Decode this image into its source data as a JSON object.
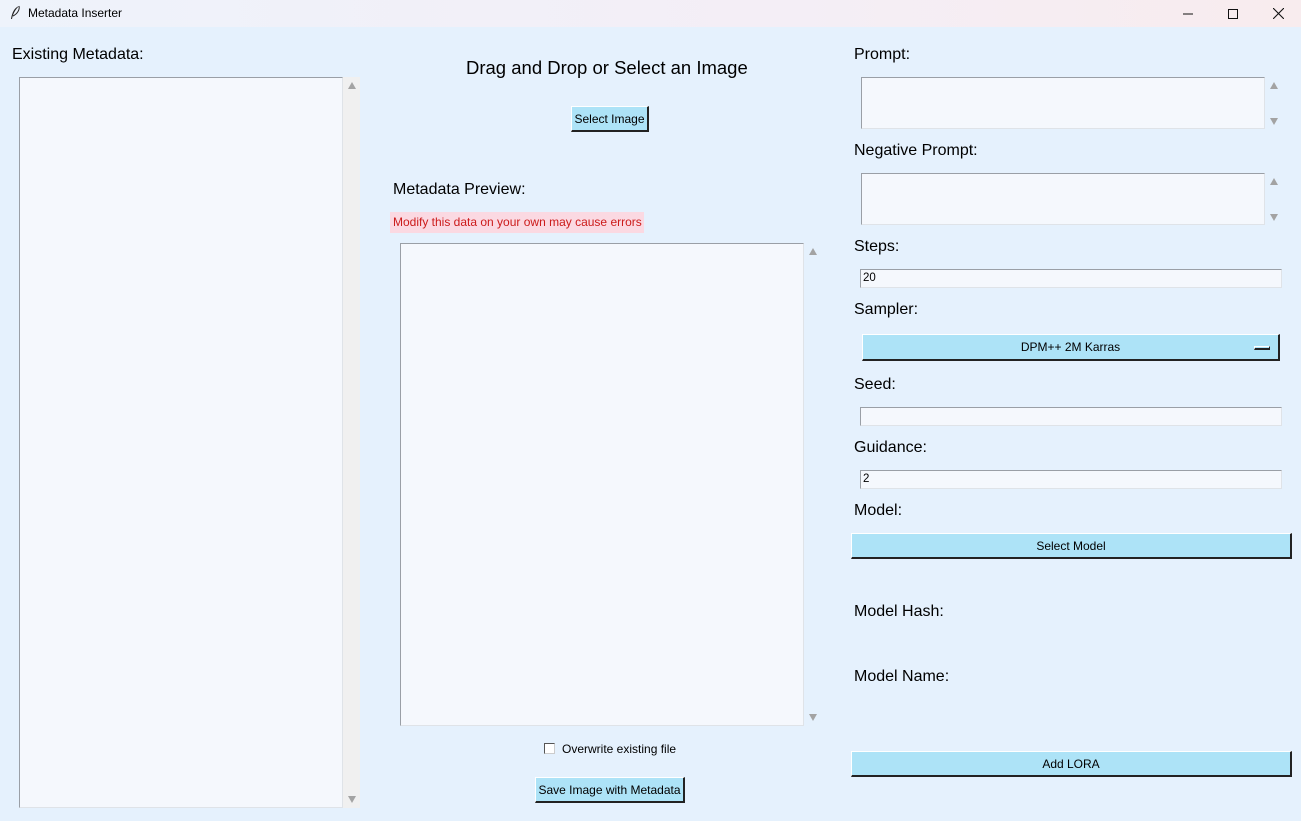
{
  "window": {
    "title": "Metadata Inserter",
    "minimize_icon": "minimize-icon",
    "maximize_icon": "maximize-icon",
    "close_icon": "close-icon"
  },
  "left": {
    "existing_metadata_label": "Existing Metadata:",
    "existing_metadata_value": ""
  },
  "center": {
    "heading": "Drag and Drop or Select an Image",
    "select_image_button": "Select Image",
    "preview_label": "Metadata Preview:",
    "warning": "Modify this data on your own may cause errors",
    "preview_value": "",
    "overwrite_label": "Overwrite existing file",
    "overwrite_checked": false,
    "save_button": "Save Image with Metadata"
  },
  "right": {
    "prompt_label": "Prompt:",
    "prompt_value": "",
    "negative_prompt_label": "Negative Prompt:",
    "negative_prompt_value": "",
    "steps_label": "Steps:",
    "steps_value": "20",
    "sampler_label": "Sampler:",
    "sampler_value": "DPM++ 2M Karras",
    "seed_label": "Seed:",
    "seed_value": "",
    "guidance_label": "Guidance:",
    "guidance_value": "2",
    "model_label": "Model:",
    "select_model_button": "Select Model",
    "model_hash_label": "Model Hash:",
    "model_name_label": "Model Name:",
    "add_lora_button": "Add LORA"
  },
  "colors": {
    "background": "#e5f1fd",
    "button": "#ade3f7",
    "warning_bg": "#fbd9e2",
    "warning_text": "#cc1b1b"
  }
}
